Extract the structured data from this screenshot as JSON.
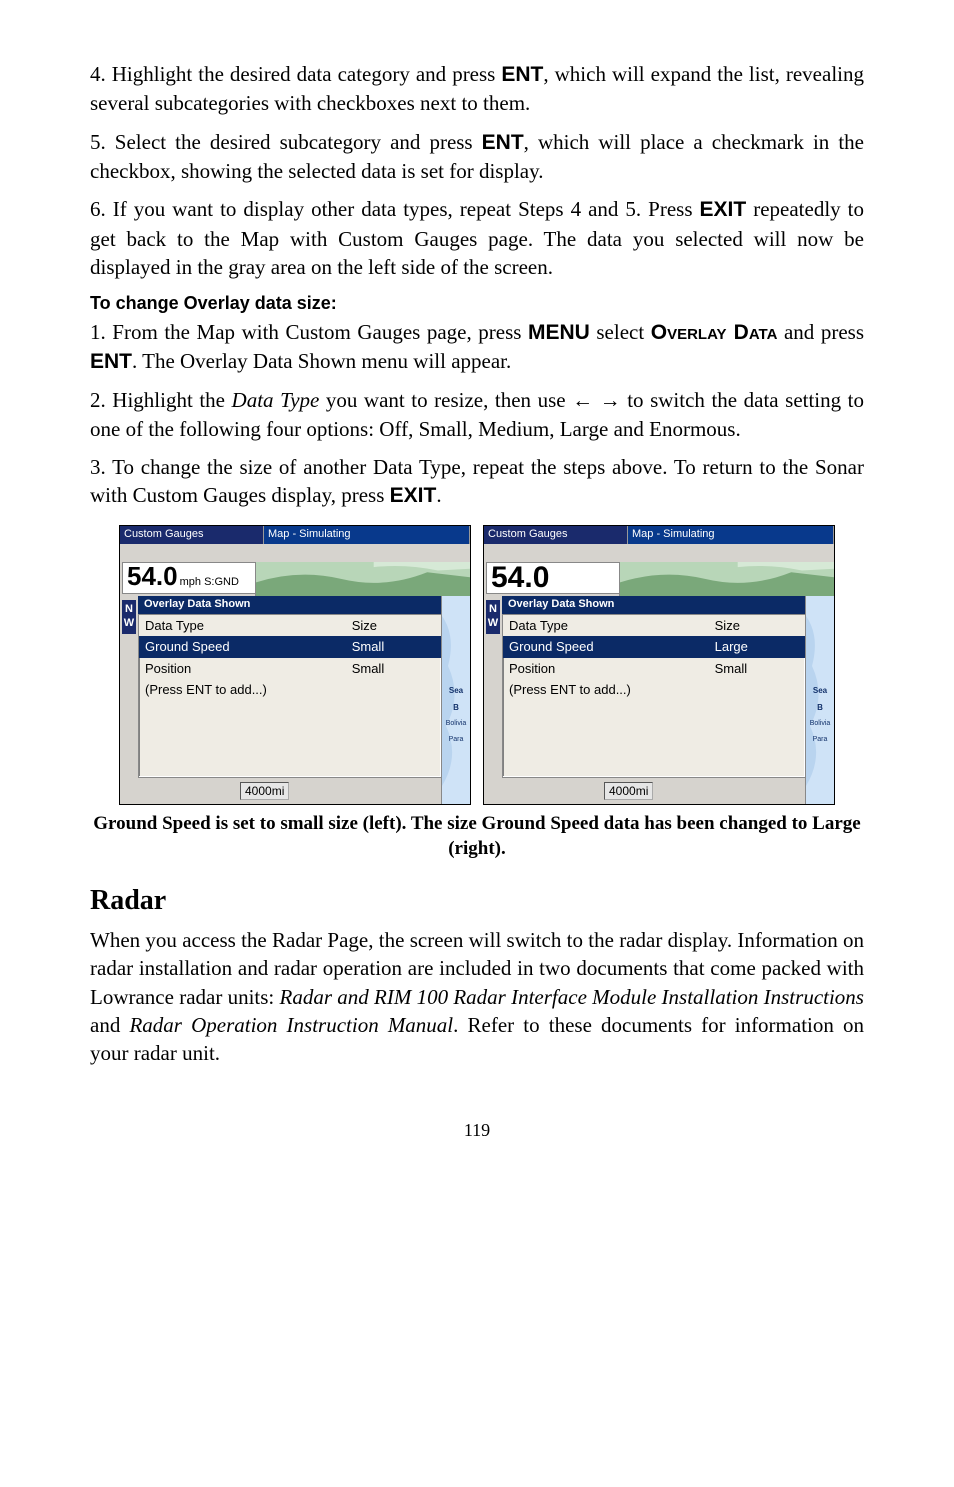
{
  "steps": {
    "s4": "4. Highlight the desired data category and press ",
    "s4b": ", which will expand the list, revealing several subcategories with checkboxes next to them.",
    "s5": "5. Select the desired subcategory and press ",
    "s5b": ", which will place a checkmark in the checkbox, showing the selected data is set for display.",
    "s6a": "6. If you want to display other data types, repeat Steps 4 and 5. Press ",
    "s6b": " repeatedly to get back to the Map with Custom Gauges page. The data you selected will now be displayed in the gray area on the left side of the screen.",
    "ent": "ENT",
    "exit": "EXIT"
  },
  "overlay_proc": {
    "heading": "To change Overlay data size:",
    "s1a": "1. From the Map with Custom Gauges page, press ",
    "menu": "MENU",
    "s1b": " select ",
    "ovdata_sc": "Overlay Data",
    "s1c": " and press ",
    "ent": "ENT",
    "s1d": ". The Overlay Data Shown menu will appear.",
    "s2a": "2. Highlight the ",
    "datatype_it": "Data Type",
    "s2b": " you want to resize, then use ",
    "arrows": "← →",
    "s2c": " to switch the data setting to one of the following four options: Off, Small, Medium, Large and Enormous.",
    "s3a": "3. To change the size of another Data Type, repeat the steps above. To return to the Sonar with Custom Gauges display, press ",
    "exit": "EXIT",
    "s3b": "."
  },
  "shots": {
    "title_left": "Custom Gauges",
    "title_right": "Map - Simulating",
    "readout_left_num": "54.0",
    "readout_left_unit": "mph S:GND",
    "readout_right_num": "54.0",
    "compass": "N\nW",
    "menubar": "Overlay Data Shown",
    "col_type": "Data Type",
    "col_size": "Size",
    "row_gs": "Ground Speed",
    "row_gs_size_s": "Small",
    "row_gs_size_l": "Large",
    "row_pos": "Position",
    "row_pos_size": "Small",
    "row_add": "(Press ENT to add...)",
    "scale": "4000mi",
    "maplabel1": "Sea",
    "maplabel2": "B",
    "maplabel3": "Bolivia",
    "maplabel4": "Para"
  },
  "caption": "Ground Speed is set to small size (left). The size Ground Speed data has been changed to Large (right).",
  "radar": {
    "heading": "Radar",
    "body_a": "When you access the Radar Page, the screen will switch to the radar display. Information on radar installation and radar operation are included in two documents that come packed with Lowrance radar units: ",
    "doc1": "Radar and RIM 100 Radar Interface Module Installation Instructions",
    "body_b": " and ",
    "doc2": "Radar Operation Instruction Manual",
    "body_c": ". Refer to these documents for information on your radar unit."
  },
  "pagenum": "119"
}
